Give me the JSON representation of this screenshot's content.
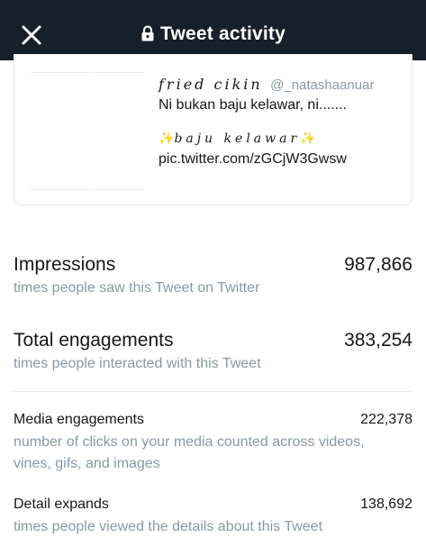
{
  "header": {
    "title": "Tweet activity",
    "close_icon": "close-icon",
    "lock_icon": "lock-icon",
    "background": "#15202b"
  },
  "tweet": {
    "display_name": "fried cikin",
    "handle": "@_natashaanuar",
    "text": "Ni bukan baju kelawar, ni.......",
    "sparkle_left": "✨",
    "styled_text": "baju kelawar",
    "sparkle_right": "✨",
    "link": "pic.twitter.com/zGCjW3Gwsw"
  },
  "metrics": {
    "impressions": {
      "title": "Impressions",
      "value": "987,866",
      "description": "times people saw this Tweet on Twitter"
    },
    "total_engagements": {
      "title": "Total engagements",
      "value": "383,254",
      "description": "times people interacted with this Tweet"
    },
    "media_engagements": {
      "title": "Media engagements",
      "value": "222,378",
      "description_line1": "number of clicks on your media counted across videos,",
      "description_line2": "vines, gifs, and images"
    },
    "detail_expands": {
      "title": "Detail expands",
      "value": "138,692",
      "description": "times people viewed the details about this Tweet"
    }
  }
}
